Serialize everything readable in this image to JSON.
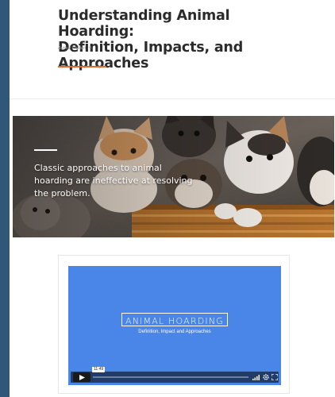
{
  "article": {
    "title_line1": "Understanding Animal Hoarding:",
    "title_line2": "Definition, Impacts, and Approaches",
    "author": "Author Hidden",
    "author_chevron": "∨"
  },
  "hero": {
    "quote_line1": "Classic approaches to animal",
    "quote_line2": "hoarding are ineffective at resolving",
    "quote_line3": "the problem."
  },
  "video": {
    "title": "ANIMAL HOARDING",
    "subtitle": "Definition, Impact and Approaches",
    "timestamp": "11:49",
    "background_color": "#4a86e8"
  },
  "icons": {
    "play": "play-icon",
    "volume": "volume-icon",
    "settings": "gear-icon",
    "fullscreen": "fullscreen-icon"
  },
  "colors": {
    "accent": "#e2662e",
    "frame": "#2f5777",
    "title_text": "#2b2b2b"
  }
}
